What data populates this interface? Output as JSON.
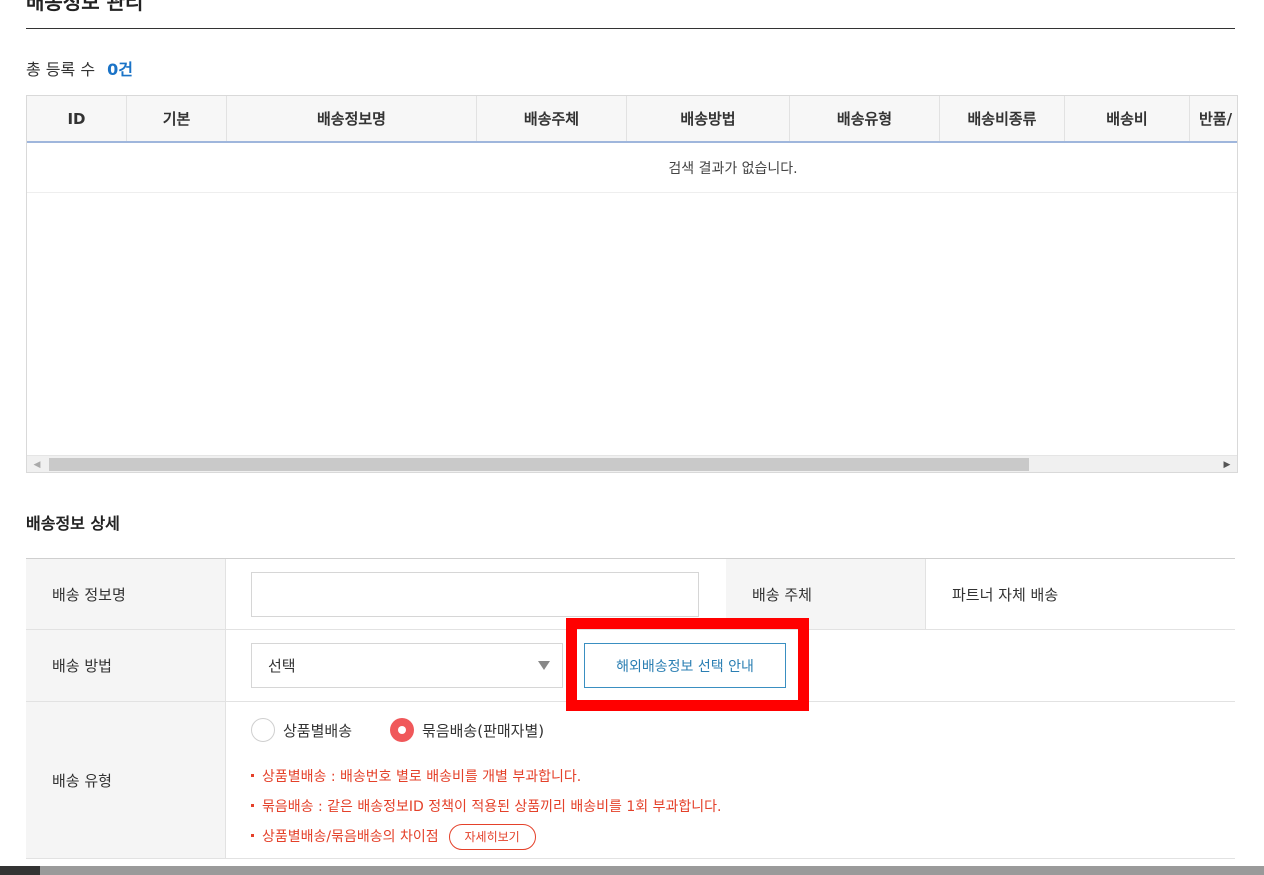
{
  "header": {
    "title_fragment": "배송정보 관리",
    "count_label": "총 등록 수",
    "count_value": "0건"
  },
  "grid": {
    "columns": [
      "ID",
      "기본",
      "배송정보명",
      "배송주체",
      "배송방법",
      "배송유형",
      "배송비종류",
      "배송비",
      "반품/"
    ],
    "empty_message": "검색 결과가 없습니다."
  },
  "detail": {
    "section_title": "배송정보 상세",
    "name_label": "배송 정보명",
    "name_value": "",
    "provider_label": "배송 주체",
    "provider_value": "파트너 자체 배송",
    "method_label": "배송 방법",
    "method_selected": "선택",
    "overseas_guide_button": "해외배송정보 선택 안내",
    "type_label": "배송 유형",
    "type_options": [
      "상품별배송",
      "묶음배송(판매자별)"
    ],
    "type_selected": "묶음배송(판매자별)",
    "notes": [
      "상품별배송 : 배송번호 별로 배송비를 개별 부과합니다.",
      "묶음배송 : 같은 배송정보ID 정책이 적용된 상품끼리 배송비를 1회 부과합니다.",
      "상품별배송/묶음배송의 차이점"
    ],
    "detail_button": "자세히보기"
  },
  "colors": {
    "accent_blue": "#1a73c7",
    "guide_button": "#2b7fb3",
    "note_red": "#e4412a",
    "radio_selected": "#f0585a",
    "highlight_box": "#ff0000"
  },
  "icons": {
    "select_caret": "triangle-down-icon",
    "scroll_left": "arrow-left-icon",
    "scroll_right": "arrow-right-icon"
  }
}
